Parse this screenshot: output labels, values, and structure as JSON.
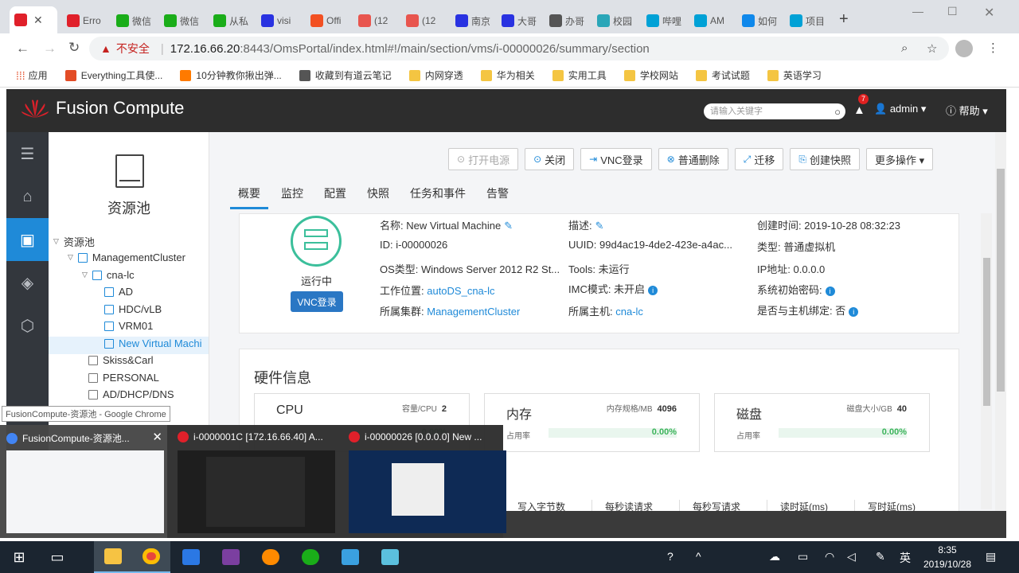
{
  "browser": {
    "tabs": [
      {
        "label": "",
        "fav": "huawei-icon",
        "color": "#e0202a",
        "active": true
      },
      {
        "label": "Erro",
        "fav": "huawei-icon",
        "color": "#e0202a"
      },
      {
        "label": "微信",
        "fav": "wechat-icon",
        "color": "#1aad19"
      },
      {
        "label": "微信",
        "fav": "wechat-icon",
        "color": "#1aad19"
      },
      {
        "label": "从私",
        "fav": "wechat-icon",
        "color": "#1aad19"
      },
      {
        "label": "visi",
        "fav": "baidu-icon",
        "color": "#2932e1"
      },
      {
        "label": "Offi",
        "fav": "microsoft-icon",
        "color": "#f25022"
      },
      {
        "label": "(12",
        "fav": "x-icon",
        "color": "#e8554e"
      },
      {
        "label": "(12",
        "fav": "x-icon",
        "color": "#e8554e"
      },
      {
        "label": "南京",
        "fav": "baidu-icon",
        "color": "#2932e1"
      },
      {
        "label": "大哥",
        "fav": "baidu-icon",
        "color": "#2932e1"
      },
      {
        "label": "办哥",
        "fav": "globe-icon",
        "color": "#555555"
      },
      {
        "label": "校园",
        "fav": "cloud-icon",
        "color": "#2aa6b8"
      },
      {
        "label": "哔哩",
        "fav": "bilibili-icon",
        "color": "#00a1d6"
      },
      {
        "label": "AM",
        "fav": "bilibili-icon",
        "color": "#00a1d6"
      },
      {
        "label": "如何",
        "fav": "zhihu-icon",
        "color": "#0f88eb"
      },
      {
        "label": "项目",
        "fav": "bilibili-icon",
        "color": "#00a1d6"
      }
    ],
    "warning": "不安全",
    "url_host": "172.16.66.20",
    "url_rest": ":8443/OmsPortal/index.html#!/main/section/vms/i-00000026/summary/section",
    "bookmarks": [
      {
        "label": "应用",
        "color": "#e34c26"
      },
      {
        "label": "Everything工具使...",
        "color": "#e34c26"
      },
      {
        "label": "10分钟教你揪出弹...",
        "color": "#ff7a00"
      },
      {
        "label": "收藏到有道云笔记",
        "color": "#555555"
      },
      {
        "label": "内网穿透",
        "color": "#f4c542"
      },
      {
        "label": "华为相关",
        "color": "#f4c542"
      },
      {
        "label": "实用工具",
        "color": "#f4c542"
      },
      {
        "label": "学校网站",
        "color": "#f4c542"
      },
      {
        "label": "考试试题",
        "color": "#f4c542"
      },
      {
        "label": "英语学习",
        "color": "#f4c542"
      }
    ]
  },
  "header": {
    "brand": "Fusion Compute",
    "search_placeholder": "请输入关键字",
    "alarm_count": "7",
    "user": "admin ▾",
    "help": "帮助 ▾"
  },
  "tree": {
    "title": "资源池",
    "nodes": [
      {
        "label": "资源池",
        "toggle": "▽"
      },
      {
        "label": "ManagementCluster",
        "toggle": "▽"
      },
      {
        "label": "cna-lc",
        "toggle": "▽"
      },
      {
        "label": "AD"
      },
      {
        "label": "HDC/vLB"
      },
      {
        "label": "VRM01"
      },
      {
        "label": "New Virtual Machi"
      },
      {
        "label": "Skiss&Carl"
      },
      {
        "label": "PERSONAL"
      },
      {
        "label": "AD/DHCP/DNS"
      },
      {
        "label": "model"
      }
    ]
  },
  "toolbar": {
    "power_on": "打开电源",
    "shutdown": "关闭",
    "vnc": "VNC登录",
    "delete": "普通删除",
    "migrate": "迁移",
    "snapshot": "创建快照",
    "more": "更多操作 ▾"
  },
  "tabs": [
    "概要",
    "监控",
    "配置",
    "快照",
    "任务和事件",
    "告警"
  ],
  "vm": {
    "state": "运行中",
    "vnc_btn": "VNC登录",
    "name": "名称: New Virtual Machine",
    "id": "ID: i-00000026",
    "os": "OS类型: Windows Server 2012 R2 St...",
    "location_label": "工作位置: ",
    "location": "autoDS_cna-lc",
    "cluster_label": "所属集群: ",
    "cluster": "ManagementCluster",
    "desc": "描述:",
    "uuid": "UUID: 99d4ac19-4de2-423e-a4ac...",
    "tools": "Tools: 未运行",
    "imc": "IMC模式: 未开启",
    "host_label": "所属主机: ",
    "host": "cna-lc",
    "created": "创建时间: 2019-10-28 08:32:23",
    "type": "类型: 普通虚拟机",
    "ip": "IP地址: 0.0.0.0",
    "initpw": "系统初始密码:",
    "bind": "是否与主机绑定: 否"
  },
  "hardware": {
    "title": "硬件信息",
    "items": [
      {
        "name": "CPU",
        "spec": "容量/CPU",
        "value": "2",
        "usage_label": "占用率",
        "usage": "0.00%"
      },
      {
        "name": "内存",
        "spec": "内存规格/MB",
        "value": "4096",
        "usage_label": "占用率",
        "usage": "0.00%"
      },
      {
        "name": "磁盘",
        "spec": "磁盘大小/GB",
        "value": "40",
        "usage_label": "占用率",
        "usage": "0.00%"
      }
    ],
    "table_head": [
      "写入字节数",
      "每秒读请求",
      "每秒写请求",
      "读时延(ms)",
      "写时延(ms)"
    ]
  },
  "preview": {
    "tooltip": "FusionCompute-资源池 - Google Chrome",
    "windows": [
      {
        "title": "FusionCompute-资源池...",
        "color": "#4285f4"
      },
      {
        "title": "i-0000001C [172.16.66.40] A...",
        "color": "#e0202a"
      },
      {
        "title": "i-00000026 [0.0.0.0] New ...",
        "color": "#e0202a"
      }
    ]
  },
  "taskbar": {
    "lang": "英",
    "time": "8:35",
    "date": "2019/10/28"
  }
}
